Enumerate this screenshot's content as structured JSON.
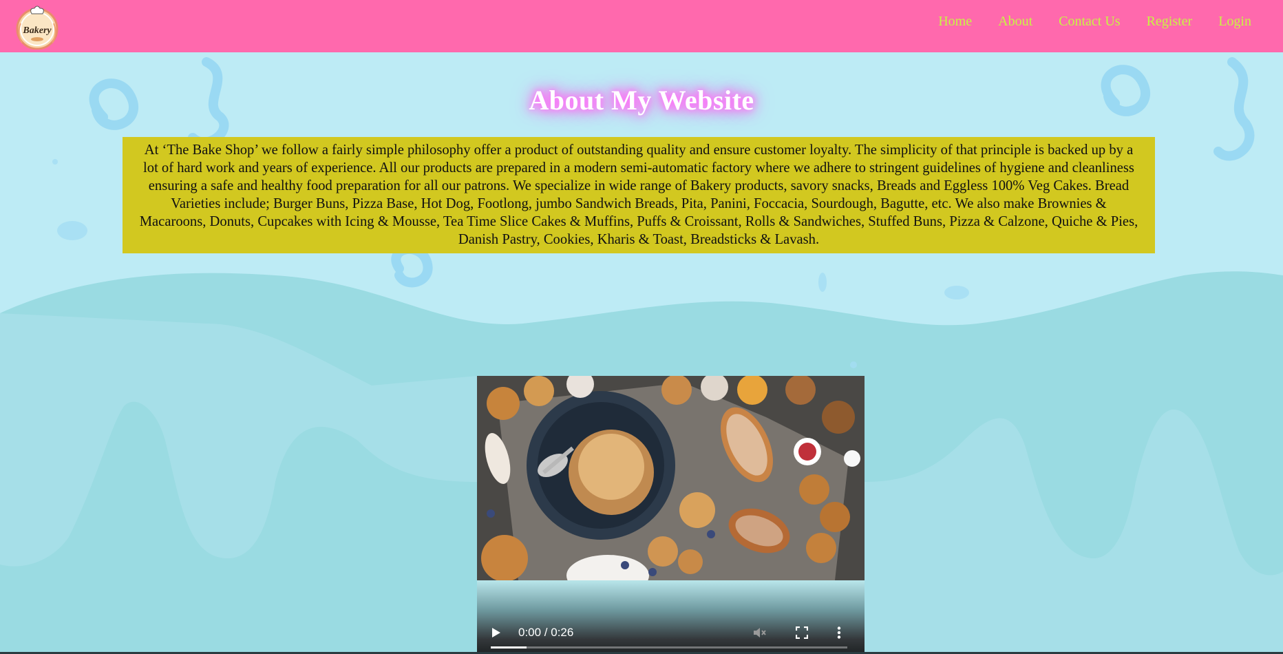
{
  "brand": {
    "logo_text": "Bakery"
  },
  "nav": {
    "items": [
      {
        "label": "Home"
      },
      {
        "label": "About"
      },
      {
        "label": "Contact Us"
      },
      {
        "label": "Register"
      },
      {
        "label": "Login"
      }
    ]
  },
  "page": {
    "title": "About My Website",
    "about_text": "At ‘The Bake Shop’ we follow a fairly simple philosophy offer a product of outstanding quality and ensure customer loyalty. The simplicity of that principle is backed up by a lot of hard work and years of experience. All our products are prepared in a modern semi-automatic factory where we adhere to stringent guidelines of hygiene and cleanliness ensuring a safe and healthy food preparation for all our patrons. We specialize in wide range of Bakery products, savory snacks, Breads and Eggless 100% Veg Cakes. Bread Varieties include; Burger Buns, Pizza Base, Hot Dog, Footlong, jumbo Sandwich Breads, Pita, Panini, Foccacia, Sourdough, Bagutte, etc. We also make Brownies & Macaroons, Donuts, Cupcakes with Icing & Mousse, Tea Time Slice Cakes & Muffins, Puffs & Croissant, Rolls & Sandwiches, Stuffed Buns, Pizza & Calzone, Quiche & Pies, Danish Pastry, Cookies, Kharis & Toast, Breadsticks & Lavash."
  },
  "video": {
    "time": "0:00 / 0:26",
    "progress": 0.1
  },
  "colors": {
    "navbar": "#ff69ad",
    "nav_link": "#c8f542",
    "background": "#bdebf5",
    "about_box": "#d2c820",
    "title_glow": "#ff7bff"
  }
}
